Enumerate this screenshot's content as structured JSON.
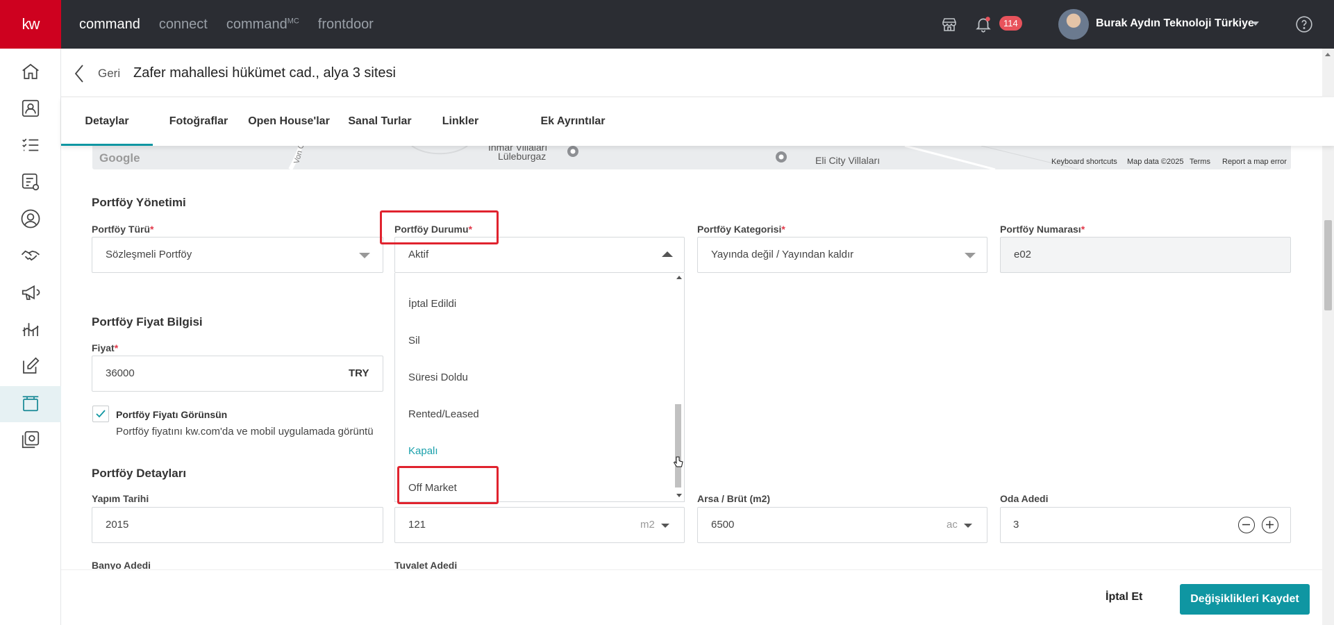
{
  "app": {
    "logo": "kw",
    "nav": [
      "command",
      "connect",
      "commandMC",
      "frontdoor"
    ],
    "nav_suffix": "MC",
    "notification_count": "114",
    "user_name": "Burak Aydın Teknoloji Türkiye"
  },
  "page": {
    "back_label": "Geri",
    "title": "Zafer mahallesi hükümet cad., alya 3 sitesi"
  },
  "tabs": [
    "Detaylar",
    "Fotoğraflar",
    "Open House'lar",
    "Sanal Turlar",
    "Linkler",
    "Ek Ayrıntılar"
  ],
  "map": {
    "google": "Google",
    "place1a": "İnmar Villaları",
    "place1b": "Lüleburgaz",
    "place2": "Eli City Villaları",
    "road": "Von C",
    "keyboard_shortcuts": "Keyboard shortcuts",
    "map_data": "Map data ©2025",
    "terms": "Terms",
    "report": "Report a map error"
  },
  "portfolio_management": {
    "title": "Portföy Yönetimi",
    "type_label": "Portföy Türü",
    "type_value": "Sözleşmeli Portföy",
    "status_label": "Portföy Durumu",
    "status_value": "Aktif",
    "category_label": "Portföy Kategorisi",
    "category_value": "Yayında değil / Yayından kaldır",
    "number_label": "Portföy Numarası",
    "number_value": "e02",
    "required_mark": "*"
  },
  "status_options": [
    "İptal Edildi",
    "Sil",
    "Süresi Doldu",
    "Rented/Leased",
    "Kapalı",
    "Off Market"
  ],
  "price": {
    "title": "Portföy Fiyat Bilgisi",
    "label": "Fiyat",
    "value": "36000",
    "currency": "TRY",
    "show_label": "Portföy Fiyatı Görünsün",
    "show_desc": "Portföy fiyatını kw.com'da ve mobil uygulamada görüntü",
    "show_checked": true
  },
  "details": {
    "title": "Portföy Detayları",
    "year_label": "Yapım Tarihi",
    "year_value": "2015",
    "area_value": "121",
    "area_unit": "m2",
    "land_label": "Arsa / Brüt (m2)",
    "land_value": "6500",
    "land_unit": "ac",
    "rooms_label": "Oda Adedi",
    "rooms_value": "3",
    "bath_label": "Banyo Adedi",
    "toilet_label": "Tuvalet Adedi"
  },
  "footer": {
    "cancel": "İptal Et",
    "save": "Değişiklikleri Kaydet"
  },
  "colors": {
    "accent": "#0f96a2",
    "brand_red": "#ce011f",
    "topbar": "#2b2d33",
    "highlight_box": "#e0232e"
  }
}
